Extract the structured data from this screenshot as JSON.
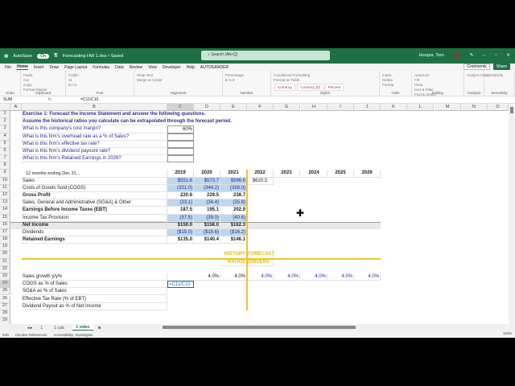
{
  "titlebar": {
    "autosave": "AutoSave",
    "toggle": "On",
    "filename": "Forecasting HW 1.xlsx • Saved",
    "search": "Search (Alt+Q)",
    "user": "Hooper, Tom"
  },
  "menu": {
    "tabs": [
      "File",
      "Home",
      "Insert",
      "Draw",
      "Page Layout",
      "Formulas",
      "Data",
      "Review",
      "View",
      "Developer",
      "Help",
      "AUTOGRADER"
    ],
    "active": "Home",
    "comments": "Comments",
    "share": "Share"
  },
  "ribbon": {
    "groups": [
      {
        "label": "Undo",
        "items": []
      },
      {
        "label": "Clipboard",
        "items": [
          "Paste",
          "Cut",
          "Copy",
          "Format Painter"
        ]
      },
      {
        "label": "Font",
        "items": [
          "Calibri",
          "11",
          "B I U"
        ]
      },
      {
        "label": "Alignment",
        "items": [
          "Wrap Text",
          "Merge & Center"
        ]
      },
      {
        "label": "Number",
        "items": [
          "Percentage",
          "$ % 9"
        ]
      },
      {
        "label": "Styles",
        "items": [
          "Conditional Formatting",
          "Format as Table"
        ],
        "styles": [
          "Currency",
          "Currency [0]",
          "Percent"
        ]
      },
      {
        "label": "Cells",
        "items": [
          "Insert",
          "Delete",
          "Format"
        ]
      },
      {
        "label": "Editing",
        "items": [
          "AutoSum",
          "Fill",
          "Clear",
          "Sort & Filter",
          "Find & Select"
        ]
      },
      {
        "label": "Analysis",
        "items": [
          "Analyze Data"
        ]
      },
      {
        "label": "Sensitivity",
        "items": [
          "Sensitivity"
        ]
      }
    ]
  },
  "formula_bar": {
    "name_box": "SUM",
    "fx": "fx",
    "formula": "=C11/C10"
  },
  "columns": [
    "A",
    "B",
    "C",
    "D",
    "E",
    "F",
    "G",
    "H",
    "I",
    "J",
    "K",
    "L",
    "M",
    "N",
    "O"
  ],
  "selected_column": "C",
  "selected_row": 24,
  "rows": [
    {
      "r": 1,
      "cells": {
        "B": {
          "v": "Exercise 1:  Forecast the Income Statement and answer the following questions.",
          "s": "qb"
        }
      }
    },
    {
      "r": 2,
      "cells": {
        "B": {
          "v": "Assume the historical ratios you calculate can be extrapolated through the forecast period.",
          "s": "qb"
        }
      }
    },
    {
      "r": 3,
      "cells": {
        "B": {
          "v": "What is this company's cost margin?",
          "s": "q"
        },
        "C": {
          "v": "60%",
          "s": "ans r"
        }
      }
    },
    {
      "r": 4,
      "cells": {
        "B": {
          "v": "What is this firm's overhead rate as a % of Sales?",
          "s": "q"
        },
        "C": {
          "v": "",
          "s": "ans"
        }
      }
    },
    {
      "r": 5,
      "cells": {
        "B": {
          "v": "What is this firm's effective tax rate?",
          "s": "q"
        },
        "C": {
          "v": "",
          "s": "ans"
        }
      }
    },
    {
      "r": 6,
      "cells": {
        "B": {
          "v": "What is this firm's dividend payount rate?",
          "s": "q"
        },
        "C": {
          "v": "",
          "s": "ans"
        }
      }
    },
    {
      "r": 7,
      "cells": {
        "B": {
          "v": "What is this firm's Retained Earnings in 2026?",
          "s": "q"
        },
        "C": {
          "v": "",
          "s": "ans"
        }
      }
    },
    {
      "r": 8,
      "cells": {}
    },
    {
      "r": 9,
      "cells": {
        "B": {
          "v": "Income Statement",
          "s": "hdr",
          "sub": "12 months ending Dec 31..."
        },
        "C": {
          "v": "2019",
          "s": "b c"
        },
        "D": {
          "v": "2020",
          "s": "b c"
        },
        "E": {
          "v": "2021",
          "s": "b c"
        },
        "F": {
          "v": "2022",
          "s": "b c"
        },
        "G": {
          "v": "2023",
          "s": "b c"
        },
        "H": {
          "v": "2024",
          "s": "b c"
        },
        "I": {
          "v": "2025",
          "s": "b c"
        },
        "J": {
          "v": "2026",
          "s": "b c"
        }
      }
    },
    {
      "r": 10,
      "cells": {
        "B": {
          "v": "Sales"
        },
        "C": {
          "v": "$551.6",
          "s": "inp r"
        },
        "D": {
          "v": "$573.7",
          "s": "inp r"
        },
        "E": {
          "v": "$596.6",
          "s": "inp r"
        },
        "F": {
          "v": "$620.5",
          "s": "c"
        }
      }
    },
    {
      "r": 11,
      "cells": {
        "B": {
          "v": "Costs of Goods Sold (COGS)"
        },
        "C": {
          "v": "(331.0)",
          "s": "inp r"
        },
        "D": {
          "v": "(344.2)",
          "s": "inp r"
        },
        "E": {
          "v": "(358.0)",
          "s": "inp r"
        }
      }
    },
    {
      "r": 12,
      "cells": {
        "B": {
          "v": "  Gross Profit",
          "s": "b"
        },
        "C": {
          "v": "220.6",
          "s": "b r"
        },
        "D": {
          "v": "229.5",
          "s": "b r"
        },
        "E": {
          "v": "238.7",
          "s": "b r"
        }
      }
    },
    {
      "r": 13,
      "cells": {
        "B": {
          "v": "Sales, General and Administrative (SG&A) & Other"
        },
        "C": {
          "v": "(33.1)",
          "s": "inp r"
        },
        "D": {
          "v": "(34.4)",
          "s": "inp r"
        },
        "E": {
          "v": "(35.8)",
          "s": "inp r"
        }
      }
    },
    {
      "r": 14,
      "cells": {
        "B": {
          "v": "  Earnings Before Income Taxes (EBT)",
          "s": "b"
        },
        "C": {
          "v": "187.5",
          "s": "b r"
        },
        "D": {
          "v": "195.1",
          "s": "b r"
        },
        "E": {
          "v": "202.9",
          "s": "b r"
        }
      }
    },
    {
      "r": 15,
      "cells": {
        "B": {
          "v": "Income Tax Provision"
        },
        "C": {
          "v": "(37.5)",
          "s": "inp r"
        },
        "D": {
          "v": "(39.0)",
          "s": "inp r"
        },
        "E": {
          "v": "(40.6)",
          "s": "inp r"
        }
      }
    },
    {
      "r": 16,
      "gray": true,
      "cells": {
        "B": {
          "v": "  Net Income",
          "s": "b"
        },
        "C": {
          "v": "$150.0",
          "s": "b r"
        },
        "D": {
          "v": "$156.0",
          "s": "b r"
        },
        "E": {
          "v": "$162.3",
          "s": "b r"
        }
      }
    },
    {
      "r": 17,
      "cells": {
        "B": {
          "v": "Dividends"
        },
        "C": {
          "v": "($15.0)",
          "s": "inp r"
        },
        "D": {
          "v": "($15.6)",
          "s": "inp r"
        },
        "E": {
          "v": "($16.2)",
          "s": "inp r"
        }
      }
    },
    {
      "r": 18,
      "cells": {
        "B": {
          "v": "  Retained Earnings",
          "s": "b"
        },
        "C": {
          "v": "$135.0",
          "s": "b r"
        },
        "D": {
          "v": "$140.4",
          "s": "b r"
        },
        "E": {
          "v": "$146.1",
          "s": "b r"
        }
      }
    },
    {
      "r": 19,
      "cells": {}
    },
    {
      "r": 20,
      "cells": {
        "E": {
          "v": "HISTORY",
          "s": "yl r"
        },
        "F": {
          "v": "FORECAST",
          "s": "yl"
        }
      }
    },
    {
      "r": 21,
      "cells": {
        "E": {
          "v": "RATIOS",
          "s": "yl r"
        },
        "F": {
          "v": "DRIVERS",
          "s": "yl"
        }
      }
    },
    {
      "r": 22,
      "cells": {}
    },
    {
      "r": 23,
      "cells": {
        "B": {
          "v": "Sales growth y/y%"
        },
        "D": {
          "v": "4.0%",
          "s": "r"
        },
        "E": {
          "v": "4.0%",
          "s": "r"
        },
        "F": {
          "v": "4.0%",
          "s": "pct r"
        },
        "G": {
          "v": "4.0%",
          "s": "pct r"
        },
        "H": {
          "v": "4.0%",
          "s": "pct r"
        },
        "I": {
          "v": "4.0%",
          "s": "pct r"
        },
        "J": {
          "v": "4.0%",
          "s": "pct r"
        }
      }
    },
    {
      "r": 24,
      "cells": {
        "B": {
          "v": "COGS as % of Sales"
        },
        "C": {
          "v": "=C11/C10",
          "s": "edit"
        }
      }
    },
    {
      "r": 25,
      "cells": {
        "B": {
          "v": "SG&A as % of Sales"
        }
      }
    },
    {
      "r": 26,
      "cells": {
        "B": {
          "v": "Effective Tax Rate (% of EBT)"
        }
      }
    },
    {
      "r": 27,
      "cells": {
        "B": {
          "v": "Dividend Payout as % of Net Income"
        }
      }
    },
    {
      "r": 28,
      "cells": {}
    },
    {
      "r": 29,
      "cells": {}
    }
  ],
  "sheet_tabs": [
    "1",
    "1 calc",
    "1 video"
  ],
  "active_sheet": "1 video",
  "status": {
    "mode": "Edit",
    "circular": "Circular References",
    "accessibility": "Accessibility: Investigate",
    "zoom": "115%"
  },
  "colors": {
    "accent": "#1e7145",
    "input_fill": "#bdd7ee",
    "divider": "#f2c12e",
    "question_text": "#2b2b8f"
  }
}
